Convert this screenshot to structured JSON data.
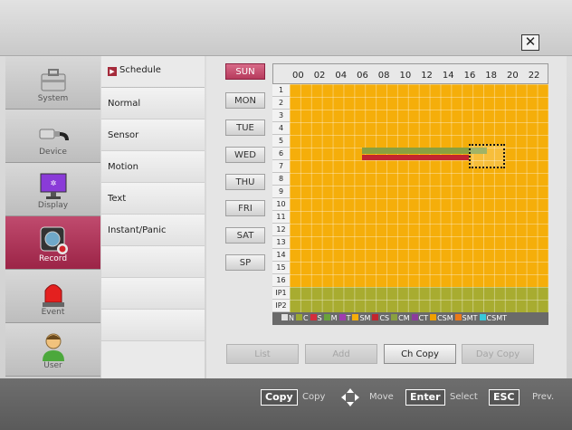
{
  "window": {
    "close_glyph": "✕"
  },
  "nav": [
    {
      "label": "System",
      "icon": "toolbox-icon"
    },
    {
      "label": "Device",
      "icon": "plug-icon"
    },
    {
      "label": "Display",
      "icon": "monitor-icon"
    },
    {
      "label": "Record",
      "icon": "camera-record-icon"
    },
    {
      "label": "Event",
      "icon": "alarm-light-icon"
    },
    {
      "label": "User",
      "icon": "user-icon"
    }
  ],
  "submenu": [
    "Schedule",
    "Normal",
    "Sensor",
    "Motion",
    "Text",
    "Instant/Panic"
  ],
  "days": [
    "SUN",
    "MON",
    "TUE",
    "WED",
    "THU",
    "FRI",
    "SAT",
    "SP"
  ],
  "hours": [
    "00",
    "02",
    "04",
    "06",
    "08",
    "10",
    "12",
    "14",
    "16",
    "18",
    "20",
    "22"
  ],
  "rows": [
    "1",
    "2",
    "3",
    "4",
    "5",
    "6",
    "7",
    "8",
    "9",
    "10",
    "11",
    "12",
    "13",
    "14",
    "15",
    "16",
    "IP1",
    "IP2"
  ],
  "legend": [
    {
      "label": "N",
      "color": "#e0e0e0"
    },
    {
      "label": "C",
      "color": "#9aa832"
    },
    {
      "label": "S",
      "color": "#d42e3c"
    },
    {
      "label": "M",
      "color": "#6aa23c"
    },
    {
      "label": "T",
      "color": "#a03cb0"
    },
    {
      "label": "SM",
      "color": "#f5ae0a"
    },
    {
      "label": "CS",
      "color": "#c2262e"
    },
    {
      "label": "CM",
      "color": "#8aa040"
    },
    {
      "label": "CT",
      "color": "#8c3c9c"
    },
    {
      "label": "CSM",
      "color": "#f0a000"
    },
    {
      "label": "SMT",
      "color": "#ea7a1a"
    },
    {
      "label": "CSMT",
      "color": "#3ac8d8"
    }
  ],
  "actions": {
    "list": "List",
    "add": "Add",
    "ch_copy": "Ch Copy",
    "day_copy": "Day Copy"
  },
  "footer": {
    "copy_key": "Copy",
    "copy_text": "Copy",
    "move_text": "Move",
    "enter_key": "Enter",
    "select_text": "Select",
    "esc_key": "ESC",
    "prev_text": "Prev."
  }
}
